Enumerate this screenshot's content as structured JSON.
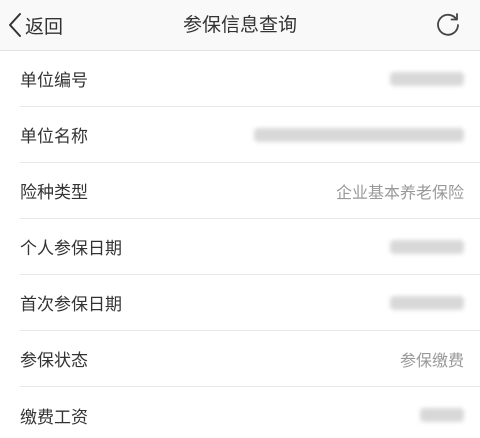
{
  "nav": {
    "back_label": "返回",
    "title": "参保信息查询",
    "back_icon": "chevron-left-icon",
    "refresh_icon": "refresh-icon"
  },
  "rows": [
    {
      "label": "单位编号",
      "value": ""
    },
    {
      "label": "单位名称",
      "value": ""
    },
    {
      "label": "险种类型",
      "value": "企业基本养老保险"
    },
    {
      "label": "个人参保日期",
      "value": ""
    },
    {
      "label": "首次参保日期",
      "value": ""
    },
    {
      "label": "参保状态",
      "value": "参保缴费"
    },
    {
      "label": "缴费工资",
      "value": ""
    }
  ],
  "colors": {
    "nav_background": "#f9f9f9",
    "text_primary": "#333333",
    "text_secondary": "#999999",
    "divider": "#e8e8e8"
  }
}
